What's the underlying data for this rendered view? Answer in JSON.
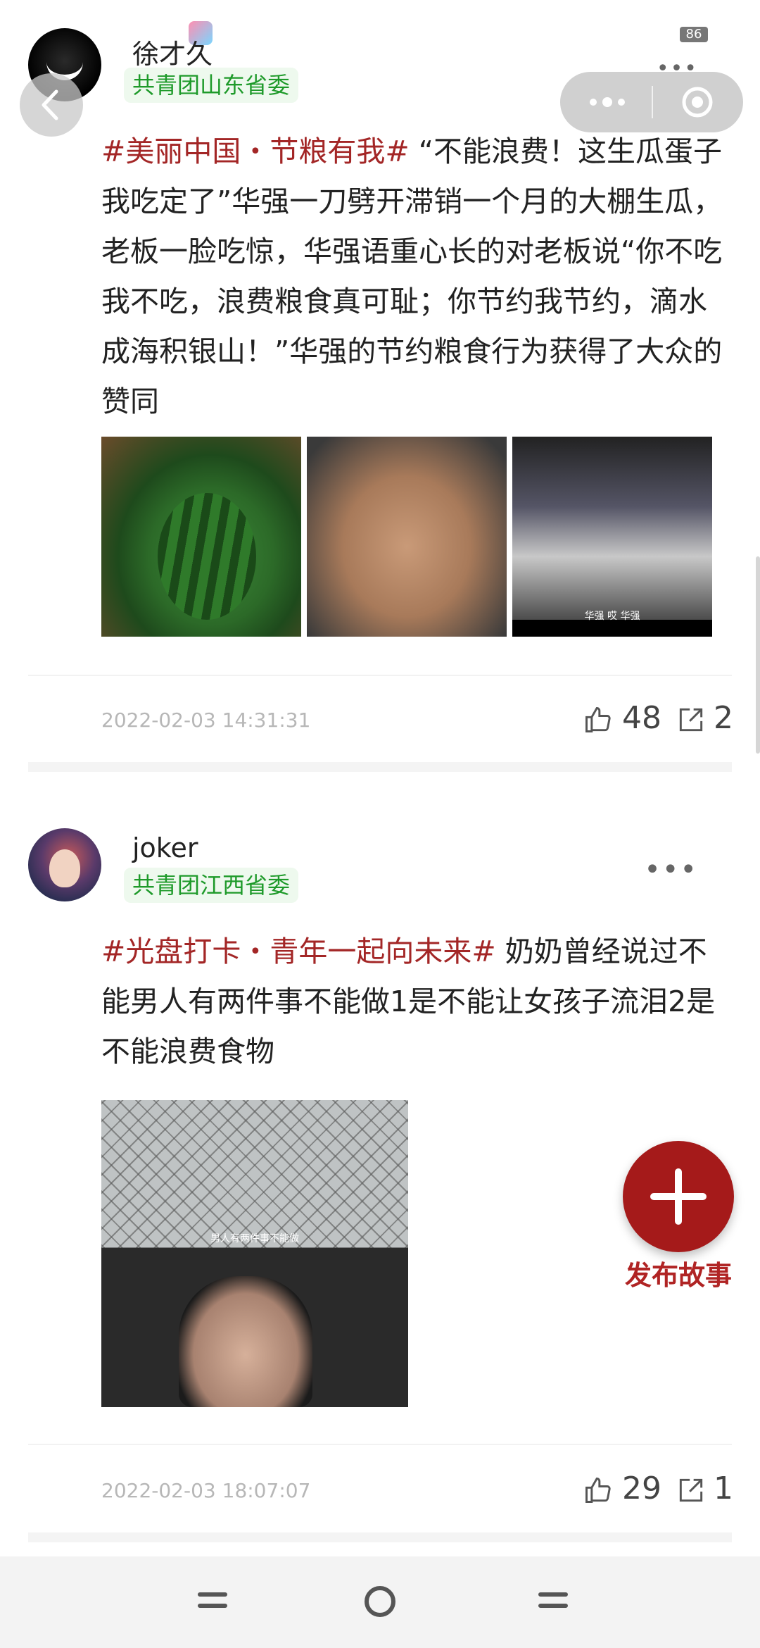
{
  "status_bar": {
    "badge_count": "86"
  },
  "posts": [
    {
      "username": "徐才久",
      "org": "共青团山东省委",
      "hashtag": "#美丽中国・节粮有我#",
      "text": " “不能浪费！这生瓜蛋子我吃定了”华强一刀劈开滞销一个月的大棚生瓜，老板一脸吃惊，华强语重心长的对老板说“你不吃我不吃，浪费粮食真可耻；你节约我节约，滴水成海积银山！”华强的节约粮食行为获得了大众的赞同",
      "image_captions": [
        "华强 哎 华强"
      ],
      "timestamp": "2022-02-03 14:31:31",
      "likes": "48",
      "shares": "2"
    },
    {
      "username": "joker",
      "org": "共青团江西省委",
      "hashtag": "#光盘打卡・青年一起向未来#",
      "text": " 奶奶曾经说过不能男人有两件事不能做1是不能让女孩子流泪2是不能浪费食物",
      "image_captions": [
        "男人有两件事不能做"
      ],
      "timestamp": "2022-02-03 18:07:07",
      "likes": "29",
      "shares": "1"
    }
  ],
  "fab": {
    "label": "发布故事"
  },
  "icons": {
    "more": "more-dots-icon",
    "like": "thumb-up-icon",
    "share": "share-icon",
    "back": "back-arrow-icon",
    "capsule_menu": "menu-dots-icon",
    "capsule_close": "target-icon",
    "add": "plus-icon"
  },
  "colors": {
    "hashtag": "#a32626",
    "org_text": "#1e9a2a",
    "fab": "#a51a1a"
  }
}
